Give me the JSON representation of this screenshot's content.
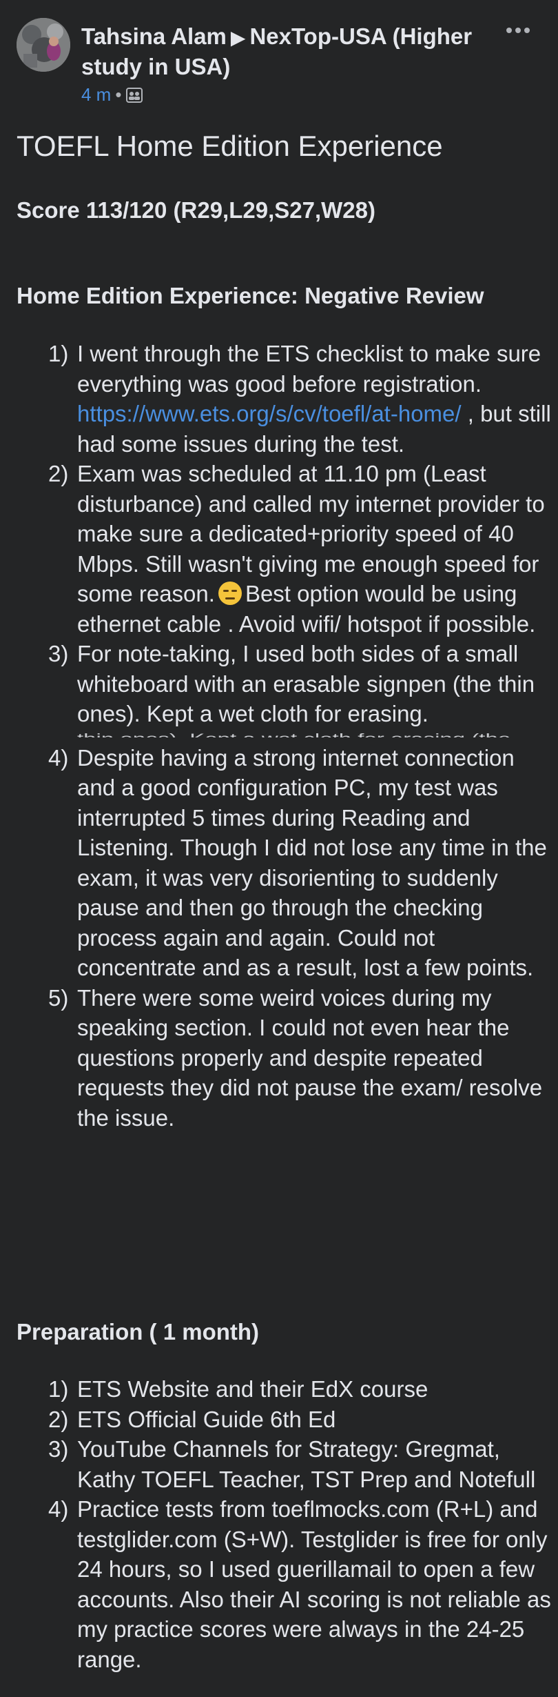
{
  "post": {
    "author": "Tahsina Alam",
    "group": "NexTop-USA (Higher study in USA)",
    "time": "4 m",
    "separator": "•",
    "audience_icon": "group-audience-icon",
    "more_icon": "more-dots-icon",
    "title": "TOEFL Home Edition Experience",
    "score": "Score 113/120 (R29,L29,S27,W28)",
    "review_heading": "Home Edition Experience: Negative Review",
    "review_items": [
      {
        "num": "1)",
        "before_link": "I went through the ETS checklist to make sure everything was good before registration.",
        "link": "https://www.ets.org/s/cv/toefl/at-home/",
        "after_link": ", but still had some issues during the test."
      },
      {
        "num": "2)",
        "text_a": "Exam was scheduled at 11.10 pm (Least disturbance) and called my internet provider to make sure a dedicated+priority speed of 40 Mbps. Still wasn't giving me enough speed for some reason.",
        "emoji": "😑",
        "text_b": "Best option would be using ethernet cable . Avoid wifi/ hotspot if possible."
      },
      {
        "num": "3)",
        "text": "For note-taking, I used both sides of a small whiteboard with an erasable signpen (the thin ones). Kept a wet cloth for erasing.",
        "glitch": "thin ones). Kept a wet cloth for erasing (the"
      },
      {
        "num": "4)",
        "text": "Despite having a strong internet connection and a good configuration PC, my test was interrupted 5 times during Reading and Listening. Though I did not lose any time in the exam, it was very disorienting to suddenly pause and then go through the checking process again and again. Could not concentrate and as a result, lost a few points."
      },
      {
        "num": "5)",
        "text": "There were some weird voices during my speaking section. I could not even hear the questions properly and despite repeated requests they did not pause the exam/ resolve the issue."
      }
    ],
    "prep_heading": "Preparation ( 1 month)",
    "prep_items": [
      {
        "num": "1)",
        "text": "ETS Website and their EdX course"
      },
      {
        "num": "2)",
        "text": "ETS Official Guide 6th Ed"
      },
      {
        "num": "3)",
        "text": "YouTube Channels for Strategy: Gregmat, Kathy TOEFL Teacher, TST Prep and Notefull"
      },
      {
        "num": "4)",
        "text": "Practice tests from toeflmocks.com (R+L) and testglider.com (S+W). Testglider is free for only 24 hours, so I used guerillamail to open a few accounts. Also their AI scoring is not reliable as my practice scores were always in the 24-25 range."
      }
    ]
  },
  "colors": {
    "background": "#242526",
    "text": "#e4e6eb",
    "link": "#4a8fe0",
    "muted": "#b0b3b8"
  }
}
